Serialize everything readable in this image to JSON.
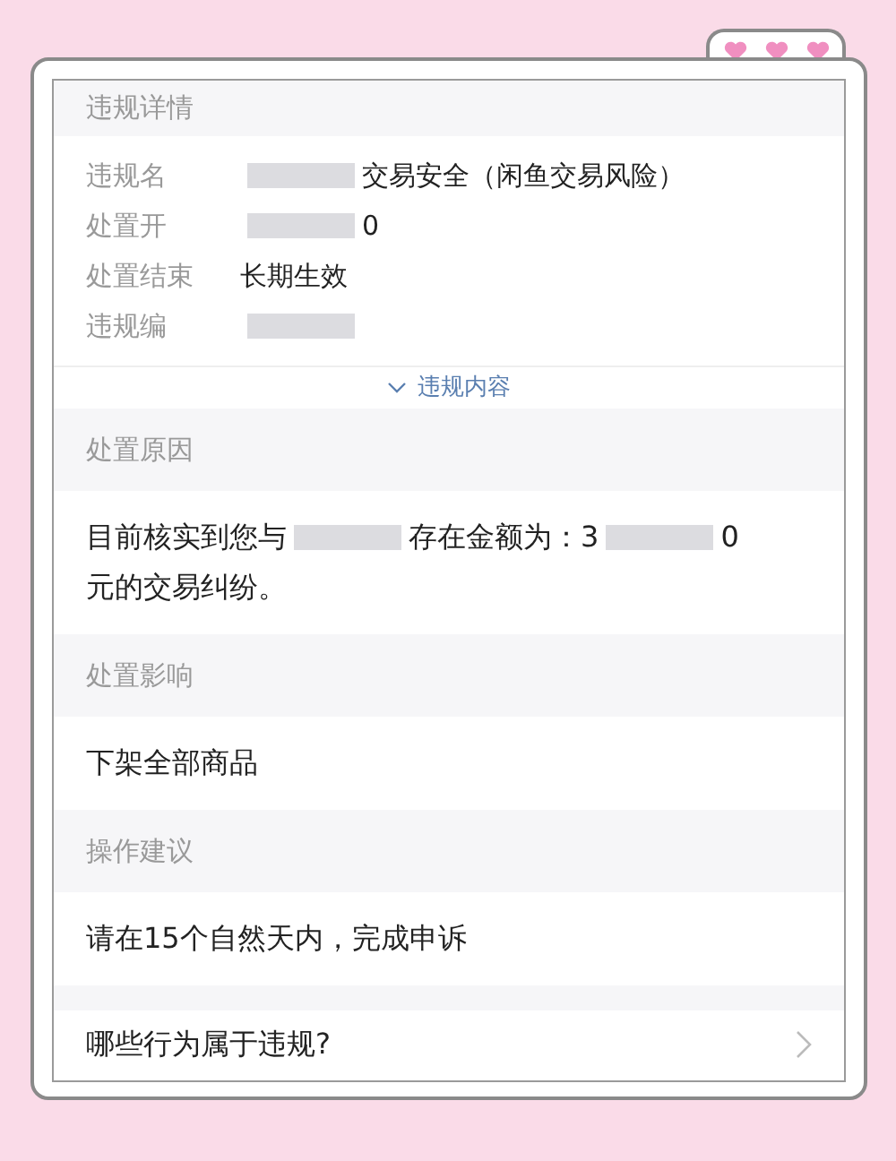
{
  "details": {
    "title": "违规详情",
    "rows": [
      {
        "label": "违规名",
        "parts": [
          {
            "kind": "redacted"
          },
          {
            "kind": "text",
            "text": "交易安全（闲鱼交易风险）"
          }
        ]
      },
      {
        "label": "处置开",
        "parts": [
          {
            "kind": "redacted"
          },
          {
            "kind": "text",
            "text": "0"
          }
        ]
      },
      {
        "label": "处置结束",
        "parts": [
          {
            "kind": "text",
            "text": "长期生效"
          }
        ]
      },
      {
        "label": "违规编",
        "parts": [
          {
            "kind": "redacted"
          }
        ]
      }
    ],
    "toggle": {
      "label": "违规内容",
      "expanded": false
    }
  },
  "sections": [
    {
      "title": "处置原因",
      "lines": [
        [
          {
            "kind": "text",
            "text": "目前核实到您与"
          },
          {
            "kind": "redacted"
          },
          {
            "kind": "text",
            "text": "存在金额为：3"
          },
          {
            "kind": "redacted"
          },
          {
            "kind": "text",
            "text": "0"
          }
        ],
        [
          {
            "kind": "text",
            "text": "元的交易纠纷。"
          }
        ]
      ]
    },
    {
      "title": "处置影响",
      "lines": [
        [
          {
            "kind": "text",
            "text": "下架全部商品"
          }
        ]
      ]
    },
    {
      "title": "操作建议",
      "lines": [
        [
          {
            "kind": "text",
            "text": "请在15个自然天内，完成申诉"
          }
        ]
      ]
    }
  ],
  "link": {
    "label": "哪些行为属于违规?"
  }
}
